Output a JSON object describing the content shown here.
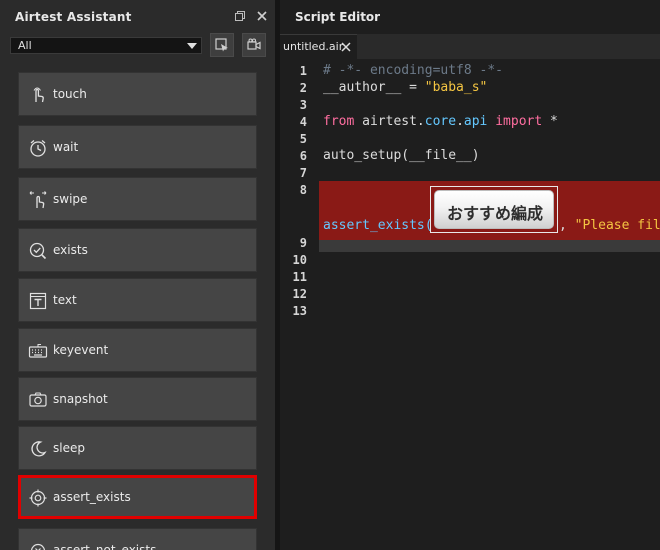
{
  "left_panel": {
    "title": "Airtest Assistant",
    "filter": {
      "selected": "All"
    },
    "commands": [
      {
        "label": "touch",
        "icon": "touch-icon"
      },
      {
        "label": "wait",
        "icon": "clock-icon"
      },
      {
        "label": "swipe",
        "icon": "swipe-icon"
      },
      {
        "label": "exists",
        "icon": "check-circle-icon"
      },
      {
        "label": "text",
        "icon": "text-icon"
      },
      {
        "label": "keyevent",
        "icon": "keyboard-icon"
      },
      {
        "label": "snapshot",
        "icon": "camera-icon"
      },
      {
        "label": "sleep",
        "icon": "moon-icon"
      },
      {
        "label": "assert_exists",
        "icon": "target-icon",
        "highlighted": true
      },
      {
        "label": "assert_not_exists",
        "icon": "cross-circle-icon"
      }
    ]
  },
  "editor": {
    "title": "Script Editor",
    "tab": {
      "label": "untitled.air"
    },
    "line_numbers": [
      "1",
      "2",
      "3",
      "4",
      "5",
      "6",
      "7",
      "8",
      "9",
      "10",
      "11",
      "12",
      "13"
    ],
    "code": {
      "l1": "# -*- encoding=utf8 -*-",
      "l2_var": "__author__ = ",
      "l2_str": "\"baba_s\"",
      "l4_from": "from",
      "l4_mod": " airtest.",
      "l4_core": "core",
      "l4_dot": ".",
      "l4_api": "api",
      "l4_import": " import",
      "l4_star": " *",
      "l6": "auto_setup(__file__)",
      "l8_func": "assert_exists(",
      "l8_after": ", ",
      "l8_str": "\"Please fil"
    },
    "image_param_text": "おすすめ編成"
  },
  "colors": {
    "highlight_border": "#e00000",
    "selected_line": "#8a1a16",
    "string": "#f4c542",
    "keyword": "#ff6ea0",
    "builtin": "#64c8ff",
    "comment": "#6c7a89"
  }
}
